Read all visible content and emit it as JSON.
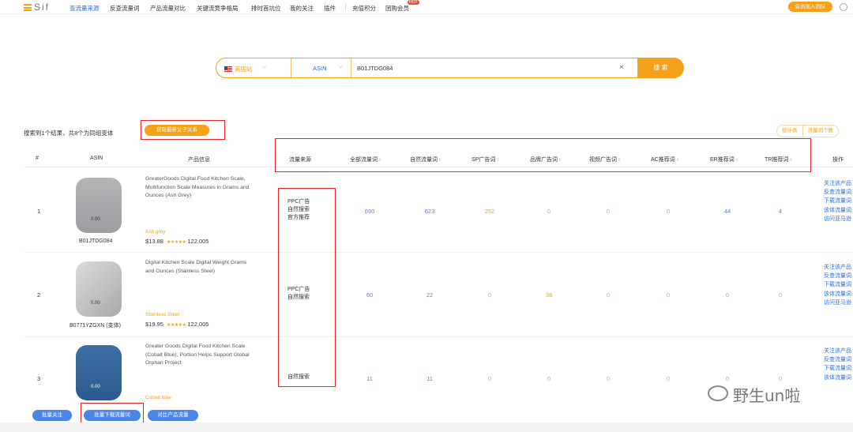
{
  "app": {
    "logo": "Sif"
  },
  "nav": {
    "items": [
      {
        "label": "查流量来源",
        "active": true
      },
      {
        "label": "反查流量词"
      },
      {
        "label": "产品流量对比"
      },
      {
        "label": "关键流竞争格局"
      },
      {
        "label": "排时首坑位"
      },
      {
        "label": "我的关注"
      },
      {
        "label": "插件"
      },
      {
        "label": "充值积分"
      },
      {
        "label": "团购会员"
      }
    ],
    "hot_badge": "HOT",
    "join_label": "会员加入团队"
  },
  "search": {
    "marketplace": "美国站",
    "type": "ASIN",
    "value": "B01JTDG084",
    "button": "搜 索"
  },
  "results": {
    "info": "搜索到1个结果，共8个为同组变体",
    "relation_button": "获取最新父子关系",
    "stat_switch": [
      "统计表",
      "流量词个数"
    ]
  },
  "columns": {
    "index": "#",
    "asin": "ASIN",
    "product": "产品信息",
    "source": "流量来源",
    "all_words": "全部流量词",
    "organic_words": "自然流量词",
    "sp_ads": "SP广告词",
    "brand_ads": "品牌广告词",
    "video_ads": "视频广告词",
    "ac_words": "AC推荐词",
    "er_words": "ER推荐词",
    "tr_words": "TR推荐词",
    "actions": "操作"
  },
  "rows": [
    {
      "index": "1",
      "asin": "B01JTDG084",
      "title": "GreaterGoods Digital Food Kitchen Scale, Multifunction Scale Measures in Grams and Ounces (Ash Grey)",
      "variant": "Ash grey",
      "price": "$13.88",
      "stars": "★★★★★",
      "reviews": "122,005",
      "sources": [
        "PPC广告",
        "自然搜索",
        "官方推荐"
      ],
      "all_words": "690",
      "organic_words": "623",
      "sp_ads": "252",
      "brand_ads": "0",
      "video_ads": "0",
      "ac_words": "0",
      "er_words": "44",
      "tr_words": "4",
      "actions": [
        "关注该产品",
        "反查流量词",
        "下载流量词",
        "该体流量词",
        "访问亚马逊"
      ]
    },
    {
      "index": "2",
      "asin": "B0771YZGXN (变体)",
      "title": "Digital Kitchen Scale Digital Weight Grams and Ounces (Stainless Steel)",
      "variant": "Stainless Steel",
      "price": "$19.95",
      "stars": "★★★★★",
      "reviews": "122,005",
      "sources": [
        "PPC广告",
        "自然搜索"
      ],
      "all_words": "60",
      "organic_words": "22",
      "sp_ads": "0",
      "brand_ads": "38",
      "video_ads": "0",
      "ac_words": "0",
      "er_words": "0",
      "tr_words": "0",
      "actions": [
        "关注该产品",
        "反查流量词",
        "下载流量词",
        "该体流量词",
        "访问亚马逊"
      ]
    },
    {
      "index": "3",
      "asin": "",
      "title": "Greater Goods Digital Food Kitchen Scale (Cobalt Blue), Portion Helps Support Global Orphan Project",
      "variant": "Cobalt blue",
      "price": "",
      "stars": "",
      "reviews": "",
      "sources": [
        "自然搜索"
      ],
      "all_words": "11",
      "organic_words": "11",
      "sp_ads": "0",
      "brand_ads": "0",
      "video_ads": "0",
      "ac_words": "0",
      "er_words": "0",
      "tr_words": "0",
      "actions": [
        "关注该产品",
        "反查流量词",
        "下载流量词",
        "该体流量词"
      ]
    }
  ],
  "bottom": {
    "follow": "批量关注",
    "download": "批量下载流量词",
    "compare": "对比产品流量"
  },
  "watermark": "野生un啦",
  "colors": {
    "accent": "#f6a11a",
    "link": "#2b6de0",
    "highlight_box": "#e22222"
  }
}
